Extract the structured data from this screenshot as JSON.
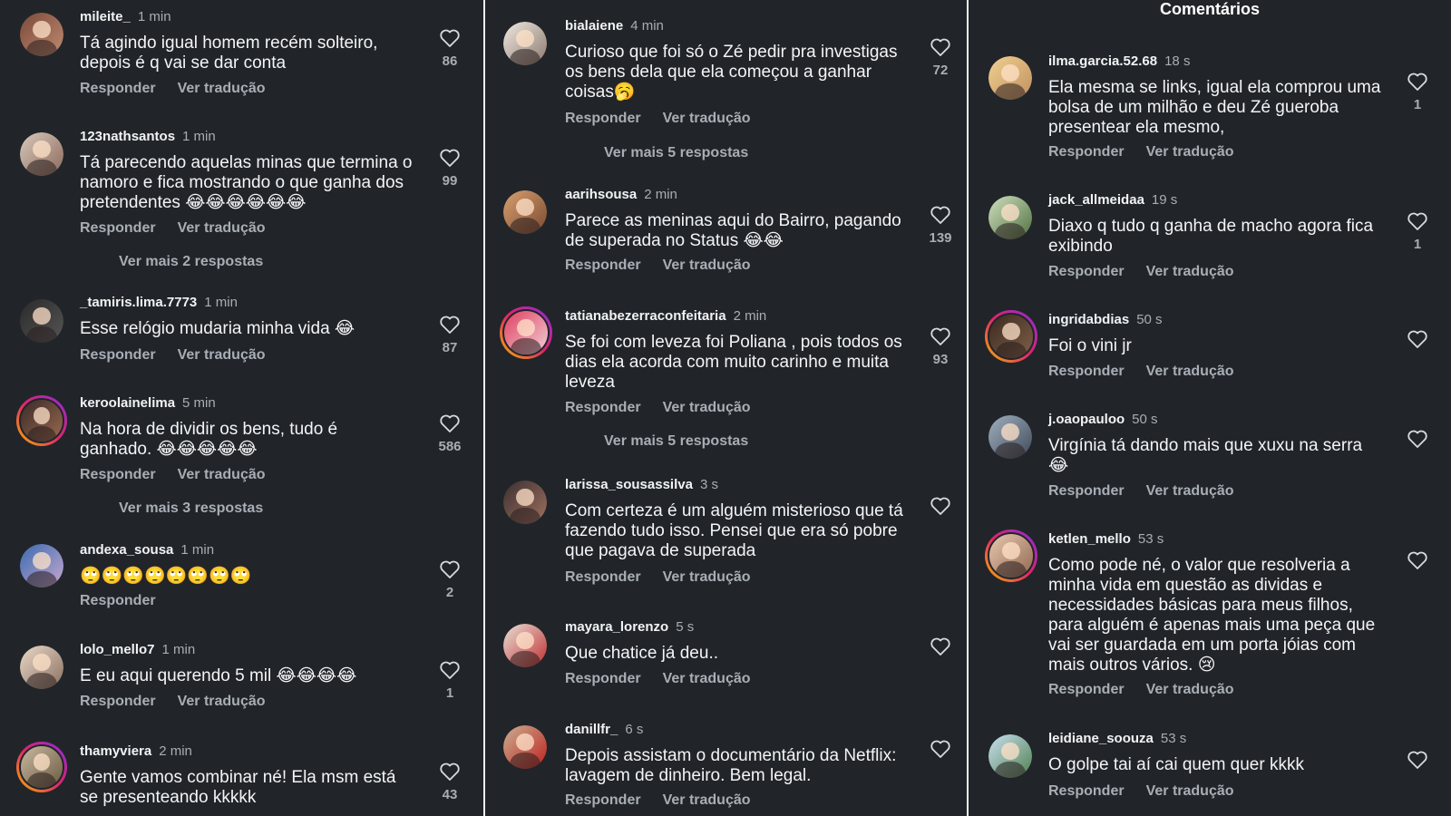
{
  "panel3": {
    "title": "Comentários"
  },
  "labels": {
    "reply": "Responder",
    "translate": "Ver tradução"
  },
  "col1": [
    {
      "user": "mileite_",
      "time": "1 min",
      "text": "Tá agindo igual homem recém solteiro, depois é q vai se dar conta",
      "likes": "86",
      "more": ""
    },
    {
      "user": "123nathsantos",
      "time": "1 min",
      "text": "Tá parecendo aquelas minas que termina o namoro e fica mostrando o que ganha dos pretendentes 😂😂😂😂😂😂",
      "likes": "99",
      "more": "Ver mais 2 respostas"
    },
    {
      "user": "_tamiris.lima.7773",
      "time": "1 min",
      "text": "Esse relógio mudaria minha vida 😂",
      "likes": "87",
      "more": ""
    },
    {
      "user": "keroolainelima",
      "time": "5 min",
      "text": "Na hora de dividir os bens, tudo é ganhado. 😂😂😂😂😂",
      "likes": "586",
      "more": "Ver mais 3 respostas"
    },
    {
      "user": "andexa_sousa",
      "time": "1 min",
      "text": "🙄🙄🙄🙄🙄🙄🙄🙄",
      "likes": "2",
      "more": ""
    },
    {
      "user": "lolo_mello7",
      "time": "1 min",
      "text": "E eu aqui querendo 5 mil 😂😂😂😂",
      "likes": "1",
      "more": ""
    },
    {
      "user": "thamyviera",
      "time": "2 min",
      "text": "Gente vamos combinar né! Ela msm está se presenteando kkkkk",
      "likes": "43",
      "more": ""
    }
  ],
  "col2": [
    {
      "user": "bialaiene",
      "time": "4 min",
      "text": "Curioso que foi só o Zé pedir pra investigas os bens dela que ela começou a ganhar coisas🥱",
      "likes": "72",
      "more": "Ver mais 5 respostas"
    },
    {
      "user": "aarihsousa",
      "time": "2 min",
      "text": "Parece as meninas aqui do Bairro, pagando de superada no Status 😂😂",
      "likes": "139",
      "more": ""
    },
    {
      "user": "tatianabezerraconfeitaria",
      "time": "2 min",
      "text": "Se foi com leveza foi Poliana , pois todos os dias ela acorda com muito carinho e muita leveza",
      "likes": "93",
      "more": "Ver mais 5 respostas"
    },
    {
      "user": "larissa_sousassilva",
      "time": "3 s",
      "text": "Com certeza é um alguém misterioso que tá fazendo tudo isso. Pensei que era só pobre que pagava de superada",
      "likes": "",
      "more": ""
    },
    {
      "user": "mayara_lorenzo",
      "time": "5 s",
      "text": "Que chatice já deu..",
      "likes": "",
      "more": ""
    },
    {
      "user": "danillfr_",
      "time": "6 s",
      "text": "Depois assistam o documentário da Netflix: lavagem de dinheiro. Bem legal.",
      "likes": "",
      "more": ""
    }
  ],
  "col3": [
    {
      "user": "ilma.garcia.52.68",
      "time": "18 s",
      "text": "Ela mesma se links, igual ela comprou uma bolsa de um milhão e deu Zé gueroba presentear ela mesmo,",
      "likes": "1",
      "more": ""
    },
    {
      "user": "jack_allmeidaa",
      "time": "19 s",
      "text": "Diaxo q tudo q ganha de macho agora fica exibindo",
      "likes": "1",
      "more": ""
    },
    {
      "user": "ingridabdias",
      "time": "50 s",
      "text": "Foi o vini jr",
      "likes": "",
      "more": ""
    },
    {
      "user": "j.oaopauloo",
      "time": "50 s",
      "text": "Virgínia tá dando mais que xuxu na serra 😂",
      "likes": "",
      "more": ""
    },
    {
      "user": "ketlen_mello",
      "time": "53 s",
      "text": "Como pode né, o valor que resolveria a minha vida em questão as dividas e necessidades básicas para meus filhos, para alguém é apenas mais uma peça que vai ser guardada em um porta jóias com mais outros vários. 😢",
      "likes": "",
      "more": ""
    },
    {
      "user": "leidiane_soouza",
      "time": "53 s",
      "text": "O golpe tai aí cai quem quer kkkk",
      "likes": "",
      "more": ""
    }
  ]
}
